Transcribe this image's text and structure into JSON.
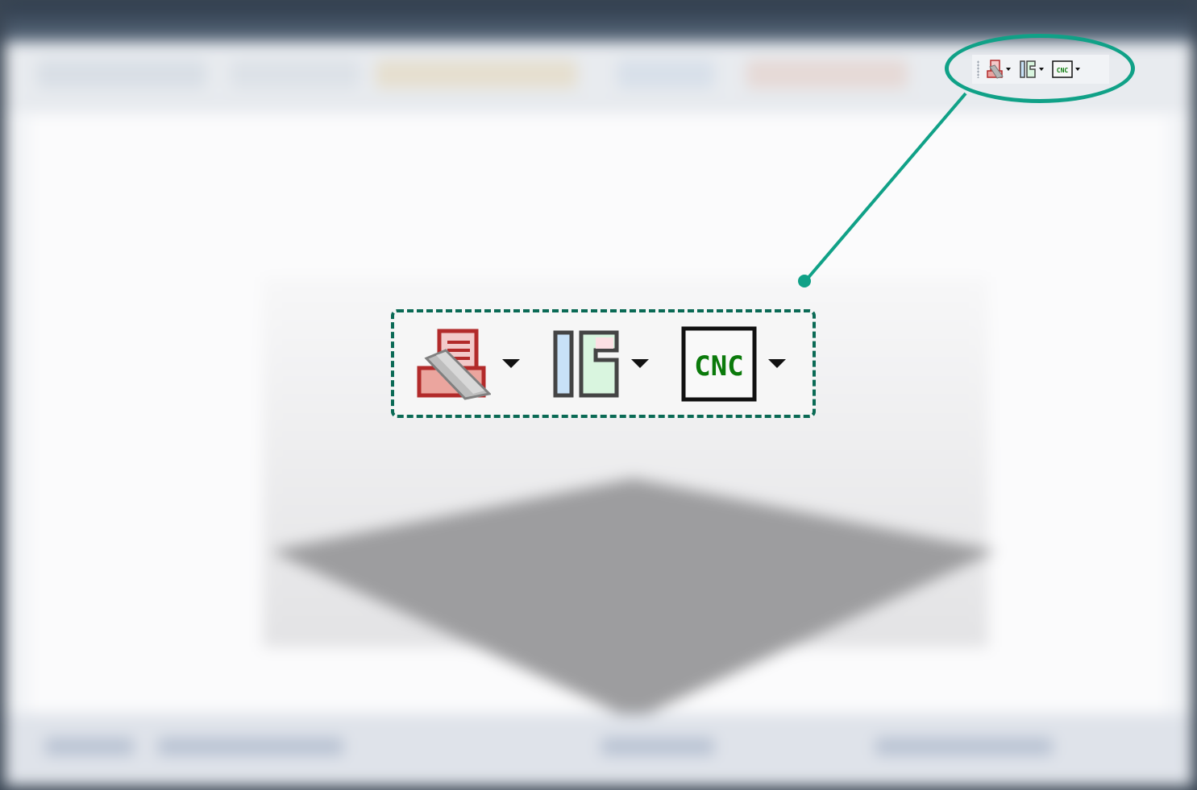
{
  "toolbar_group": {
    "buttons": [
      {
        "icon": "print-laser-icon",
        "has_dropdown": true
      },
      {
        "icon": "layout-panels-icon",
        "has_dropdown": true
      },
      {
        "icon": "cnc-icon",
        "label": "CNC",
        "has_dropdown": true
      }
    ]
  },
  "zoom_callout": {
    "cnc_label": "CNC"
  },
  "colors": {
    "highlight": "#10a187",
    "dashed_border": "#0a6a55",
    "cnc_text": "#0b7a0b",
    "print_icon_red": "#b22a2a",
    "panel_blue": "#c8e1f7",
    "panel_green": "#d9f5df"
  }
}
